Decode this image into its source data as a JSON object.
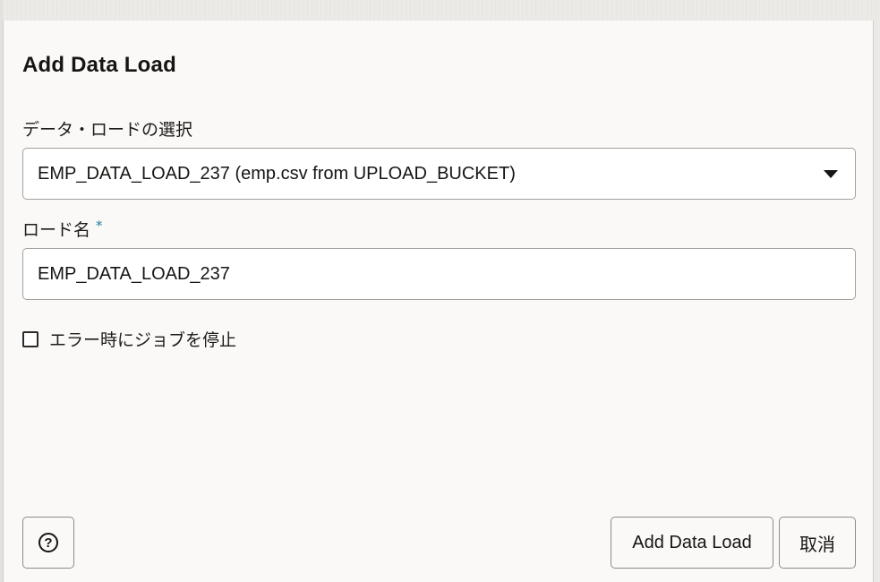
{
  "dialog": {
    "title": "Add Data Load",
    "select_label": "データ・ロードの選択",
    "select_value": "EMP_DATA_LOAD_237 (emp.csv from UPLOAD_BUCKET)",
    "name_label": "ロード名",
    "name_required_marker": "*",
    "name_value": "EMP_DATA_LOAD_237",
    "stop_on_error_label": "エラー時にジョブを停止",
    "stop_on_error_checked": false,
    "help_symbol": "?",
    "add_button_label": "Add Data Load",
    "cancel_button_label": "取消"
  },
  "icons": {
    "caret": "chevron-down-icon",
    "help": "help-circle-icon"
  }
}
